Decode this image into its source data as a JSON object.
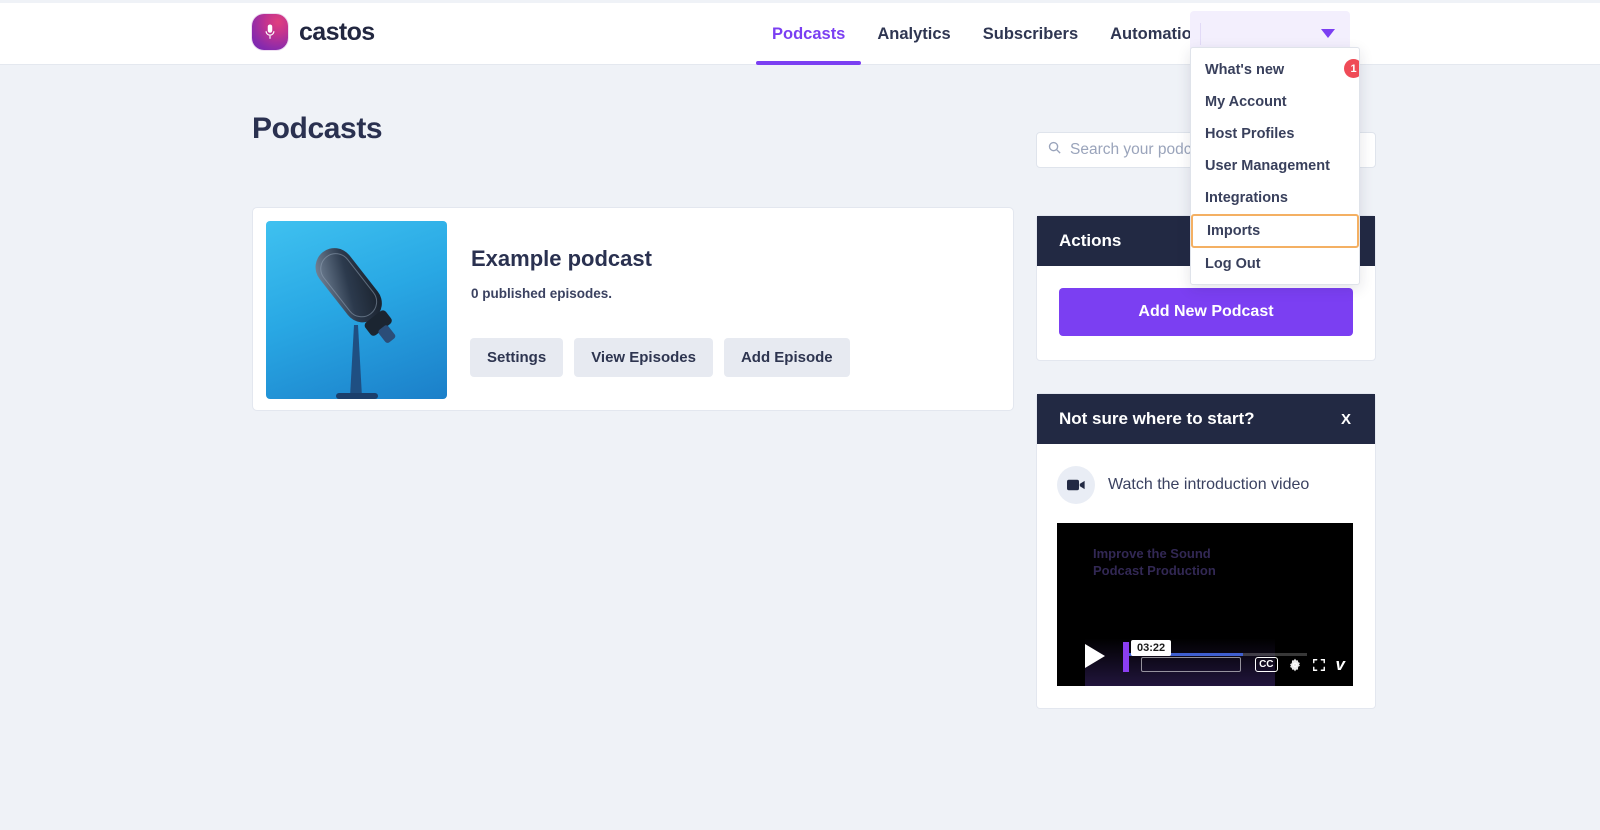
{
  "brand": {
    "name": "castos",
    "logo_icon": "microphone-icon"
  },
  "nav": {
    "items": [
      {
        "label": "Podcasts",
        "active": true
      },
      {
        "label": "Analytics",
        "active": false
      },
      {
        "label": "Subscribers",
        "active": false
      },
      {
        "label": "Automations",
        "active": false
      }
    ],
    "user_menu_caret_icon": "chevron-down-icon"
  },
  "dropdown": {
    "items": [
      {
        "label": "What's new",
        "badge": "1",
        "focused": false
      },
      {
        "label": "My Account",
        "badge": "",
        "focused": false
      },
      {
        "label": "Host Profiles",
        "badge": "",
        "focused": false
      },
      {
        "label": "User Management",
        "badge": "",
        "focused": false
      },
      {
        "label": "Integrations",
        "badge": "",
        "focused": false
      },
      {
        "label": "Imports",
        "badge": "",
        "focused": true
      },
      {
        "label": "Log Out",
        "badge": "",
        "focused": false
      }
    ]
  },
  "page": {
    "title": "Podcasts"
  },
  "search": {
    "value": "",
    "placeholder": "Search your podcasts",
    "icon": "search-icon"
  },
  "podcast": {
    "title": "Example podcast",
    "episodes_text": "0 published episodes.",
    "artwork_icon": "microphone-artwork",
    "buttons": [
      {
        "label": "Settings"
      },
      {
        "label": "View Episodes"
      },
      {
        "label": "Add Episode"
      }
    ]
  },
  "actions_panel": {
    "header": "Actions",
    "primary_button": "Add New Podcast"
  },
  "start_panel": {
    "header": "Not sure where to start?",
    "close_label": "X",
    "video_link_label": "Watch the introduction video",
    "video_link_icon": "video-camera-icon",
    "player": {
      "time_tooltip": "03:22",
      "play_icon": "play-icon",
      "cc_label": "CC",
      "settings_icon": "gear-icon",
      "fullscreen_icon": "fullscreen-icon",
      "provider_logo": "vimeo-logo",
      "ghost_text_line1": "Improve the Sound",
      "ghost_text_line2": "Podcast Production"
    }
  },
  "colors": {
    "accent": "#7b3ff2",
    "panel_header": "#222943",
    "badge": "#ef4b57",
    "focus_ring": "#f4b063",
    "page_background": "#eff2f7"
  }
}
